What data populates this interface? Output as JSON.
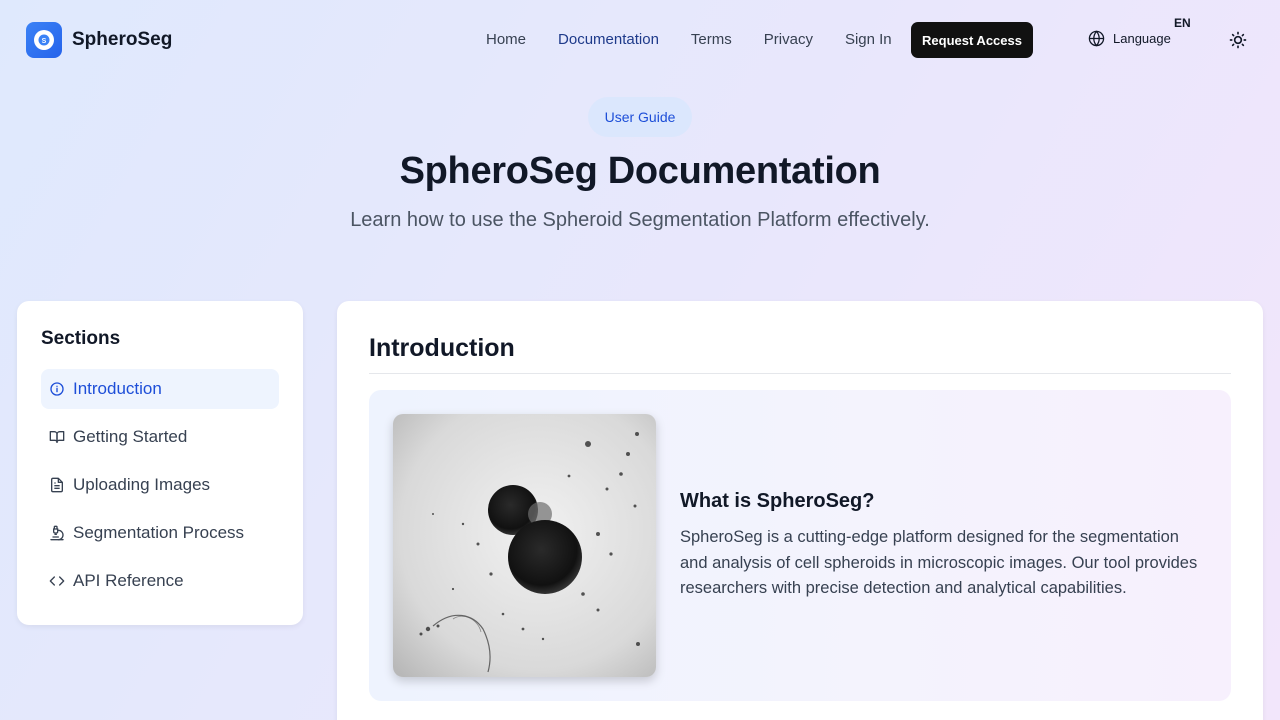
{
  "header": {
    "logo_text": "SpheroSeg",
    "nav": [
      "Home",
      "Documentation",
      "Terms",
      "Privacy",
      "Sign In"
    ],
    "active_nav": "Documentation",
    "request_access_label": "Request Access",
    "language_label": "Language",
    "language_code": "EN"
  },
  "hero": {
    "badge": "User Guide",
    "title": "SpheroSeg Documentation",
    "subtitle": "Learn how to use the Spheroid Segmentation Platform effectively."
  },
  "sidebar": {
    "title": "Sections",
    "items": [
      {
        "label": "Introduction",
        "icon": "info-icon",
        "active": true
      },
      {
        "label": "Getting Started",
        "icon": "book-open-icon",
        "active": false
      },
      {
        "label": "Uploading Images",
        "icon": "file-text-icon",
        "active": false
      },
      {
        "label": "Segmentation Process",
        "icon": "microscope-icon",
        "active": false
      },
      {
        "label": "API Reference",
        "icon": "code-icon",
        "active": false
      }
    ]
  },
  "main": {
    "section_title": "Introduction",
    "card_title": "What is SpheroSeg?",
    "card_body": "SpheroSeg is a cutting-edge platform designed for the segmentation and analysis of cell spheroids in microscopic images. Our tool provides researchers with precise detection and analytical capabilities."
  },
  "colors": {
    "accent": "#2563eb",
    "active_nav": "#1e3a8a",
    "button_bg": "#111111"
  }
}
